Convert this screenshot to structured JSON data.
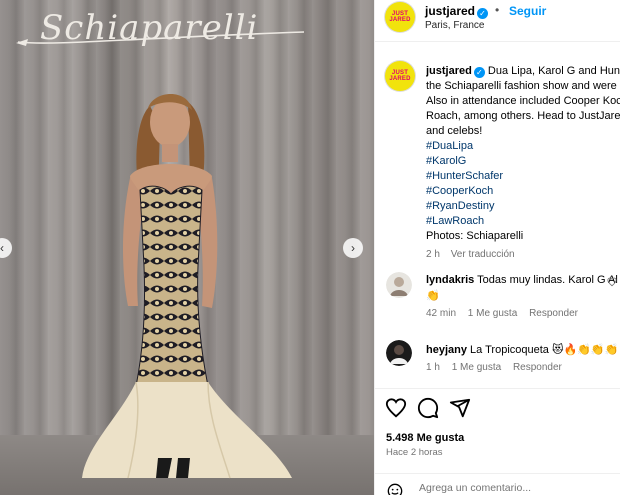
{
  "photo": {
    "sign_text": "Schiaparelli",
    "prev_icon": "chevron-left-icon",
    "next_icon": "chevron-right-icon"
  },
  "post": {
    "username": "justjared",
    "avatar_logo_line1": "JUST",
    "avatar_logo_line2": "JARED",
    "verified_icon": "check",
    "follow_label": "Seguir",
    "separator": "•",
    "location": "Paris, France"
  },
  "caption": {
    "line1": "Dua Lipa, Karol G and Hunt",
    "line2": "the Schiaparelli fashion show and were",
    "line3": "Also in attendance included Cooper Koc",
    "line4": "Roach, among others. Head to JustJared",
    "line5": "and celebs!",
    "hashtags": [
      "#DuaLipa",
      "#KarolG",
      "#HunterSchafer",
      "#CooperKoch",
      "#RyanDestiny",
      "#LawRoach"
    ],
    "credits": "Photos: Schiaparelli",
    "time": "2 h",
    "translate": "Ver traducción"
  },
  "comments": [
    {
      "username": "lyndakris",
      "text": "Todas muy lindas. Karol G Al f",
      "emoji_line": "👏",
      "time": "42 min",
      "likes": "1 Me gusta",
      "reply": "Responder"
    },
    {
      "username": "heyjany",
      "text": "La Tropicoqueta 😻🔥👏👏👏",
      "time": "1 h",
      "likes": "1 Me gusta",
      "reply": "Responder"
    }
  ],
  "actions": {
    "likes_count": "5.498 Me gusta",
    "posted_ago": "Hace 2 horas",
    "comment_placeholder": "Agrega un comentario..."
  },
  "colors": {
    "accent": "#0095f6",
    "hashtag": "#00376b",
    "avatar_bg": "#f1e30d",
    "logo_text": "#e2006e"
  }
}
